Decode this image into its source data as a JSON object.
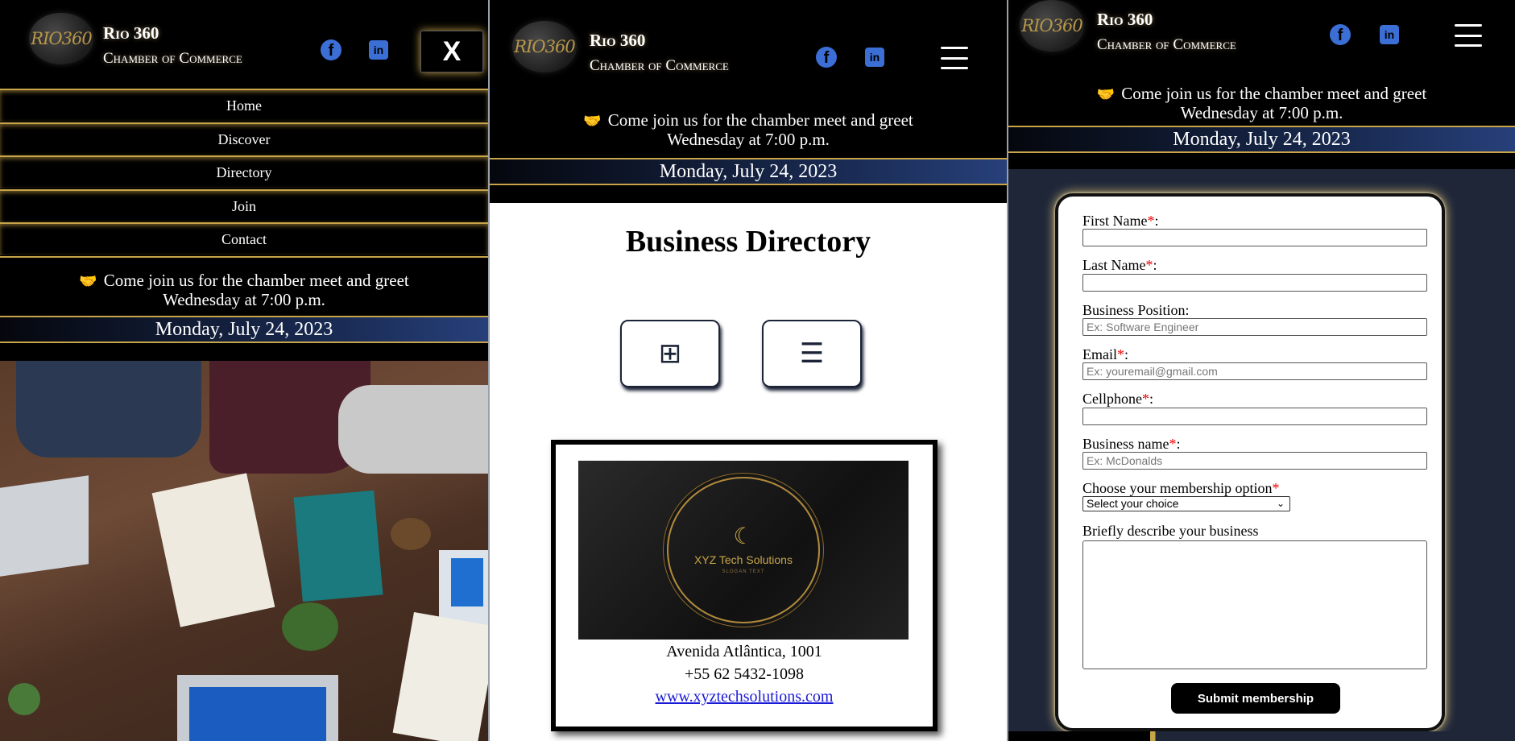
{
  "brand": {
    "logo_text": "RIO360",
    "line1": "Rio 360",
    "line2": "Chamber of Commerce"
  },
  "social": {
    "facebook": "f",
    "linkedin": "in"
  },
  "nav": {
    "close_label": "X",
    "items": [
      "Home",
      "Discover",
      "Directory",
      "Join",
      "Contact"
    ]
  },
  "announcement": {
    "line1": "Come join us for the chamber meet and greet",
    "line2": "Wednesday at 7:00 p.m."
  },
  "date": "Monday, July 24, 2023",
  "directory": {
    "title": "Business Directory",
    "grid_icon": "⊞",
    "list_icon": "☰",
    "card": {
      "logo_name": "XYZ Tech Solutions",
      "logo_tagline": "SLOGAN TEXT",
      "address": "Avenida Atlântica, 1001",
      "phone": "+55 62 5432-1098",
      "website": "www.xyztechsolutions.com"
    }
  },
  "form": {
    "first_name_label": "First Name",
    "last_name_label": "Last Name",
    "position_label": "Business Position:",
    "position_placeholder": "Ex: Software Engineer",
    "email_label": "Email",
    "email_placeholder": "Ex: youremail@gmail.com",
    "cellphone_label": "Cellphone",
    "business_name_label": "Business name",
    "business_name_placeholder": "Ex: McDonalds",
    "membership_label": "Choose your membership option",
    "membership_selected": "Select your choice",
    "describe_label": "Briefly describe your business",
    "required_mark": "*",
    "colon": ":",
    "submit_label": "Submit membership"
  },
  "colors": {
    "gold": "#c9a54a",
    "navy": "#1b2336",
    "social_blue": "#3b6fd6"
  }
}
